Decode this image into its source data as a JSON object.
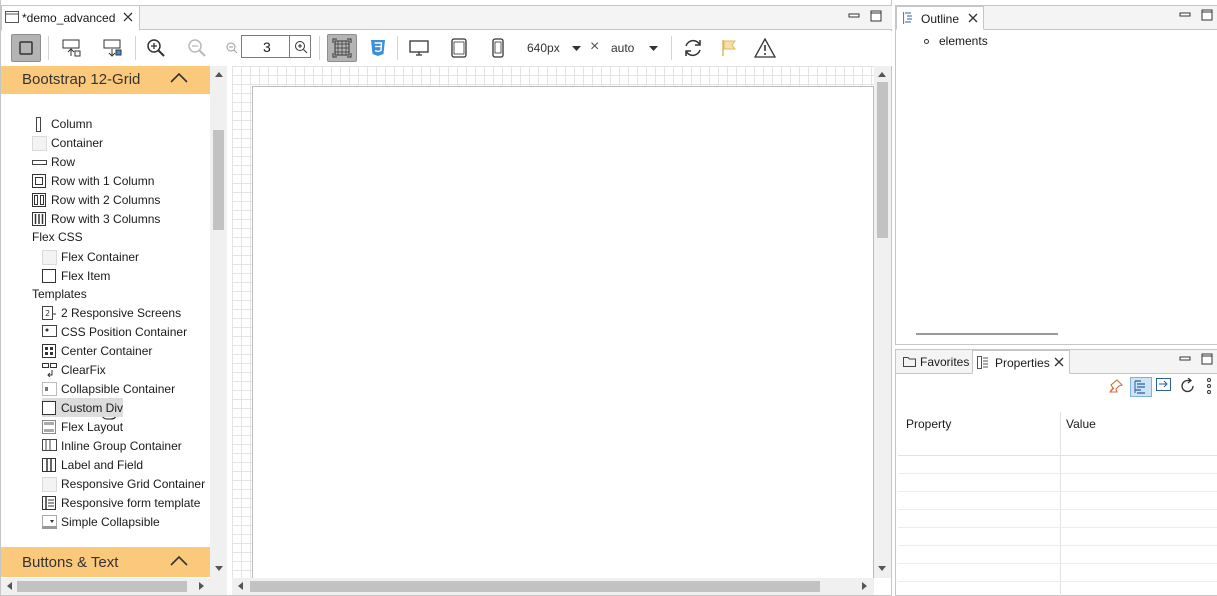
{
  "editor": {
    "tab_title": "*demo_advanced",
    "zoom_value": "3",
    "width_value": "640px",
    "size_separator": "×",
    "height_value": "auto"
  },
  "palette": {
    "drawers": {
      "grid": "Bootstrap 12-Grid",
      "buttons": "Buttons & Text"
    },
    "items": [
      {
        "label": "Column",
        "icon": "column-icon"
      },
      {
        "label": "Container",
        "icon": "container-icon"
      },
      {
        "label": "Row",
        "icon": "row-icon"
      },
      {
        "label": "Row with 1 Column",
        "icon": "row-1-column-icon"
      },
      {
        "label": "Row with 2 Columns",
        "icon": "row-2-columns-icon"
      },
      {
        "label": "Row with 3 Columns",
        "icon": "row-3-columns-icon"
      }
    ],
    "flex_category": "Flex CSS",
    "flex_items": [
      {
        "label": "Flex Container",
        "icon": "flex-container-icon"
      },
      {
        "label": "Flex Item",
        "icon": "flex-item-icon"
      }
    ],
    "templates_category": "Templates",
    "templates": [
      {
        "label": "2 Responsive Screens",
        "icon": "responsive-screens-icon"
      },
      {
        "label": "CSS Position Container",
        "icon": "css-position-icon"
      },
      {
        "label": "Center Container",
        "icon": "center-container-icon"
      },
      {
        "label": "ClearFix",
        "icon": "clearfix-icon"
      },
      {
        "label": "Collapsible Container",
        "icon": "collapsible-icon"
      },
      {
        "label": "Custom Div",
        "icon": "custom-div-icon"
      },
      {
        "label": "Flex Layout",
        "icon": "flex-layout-icon"
      },
      {
        "label": "Inline Group Container",
        "icon": "inline-group-icon"
      },
      {
        "label": "Label and Field",
        "icon": "label-field-icon"
      },
      {
        "label": "Responsive Grid Container",
        "icon": "responsive-grid-icon"
      },
      {
        "label": "Responsive form template",
        "icon": "responsive-form-icon"
      },
      {
        "label": "Simple Collapsible",
        "icon": "simple-collapsible-icon"
      }
    ]
  },
  "outline": {
    "tab_title": "Outline",
    "root_item": "elements"
  },
  "properties": {
    "tab_favorites": "Favorites",
    "tab_properties": "Properties",
    "col_property": "Property",
    "col_value": "Value"
  },
  "colors": {
    "drawer_bg": "#fbc97b",
    "pressed_bg": "#b4b4b4",
    "css_icon": "#3c8fd6",
    "flag_icon": "#f0c86a"
  }
}
